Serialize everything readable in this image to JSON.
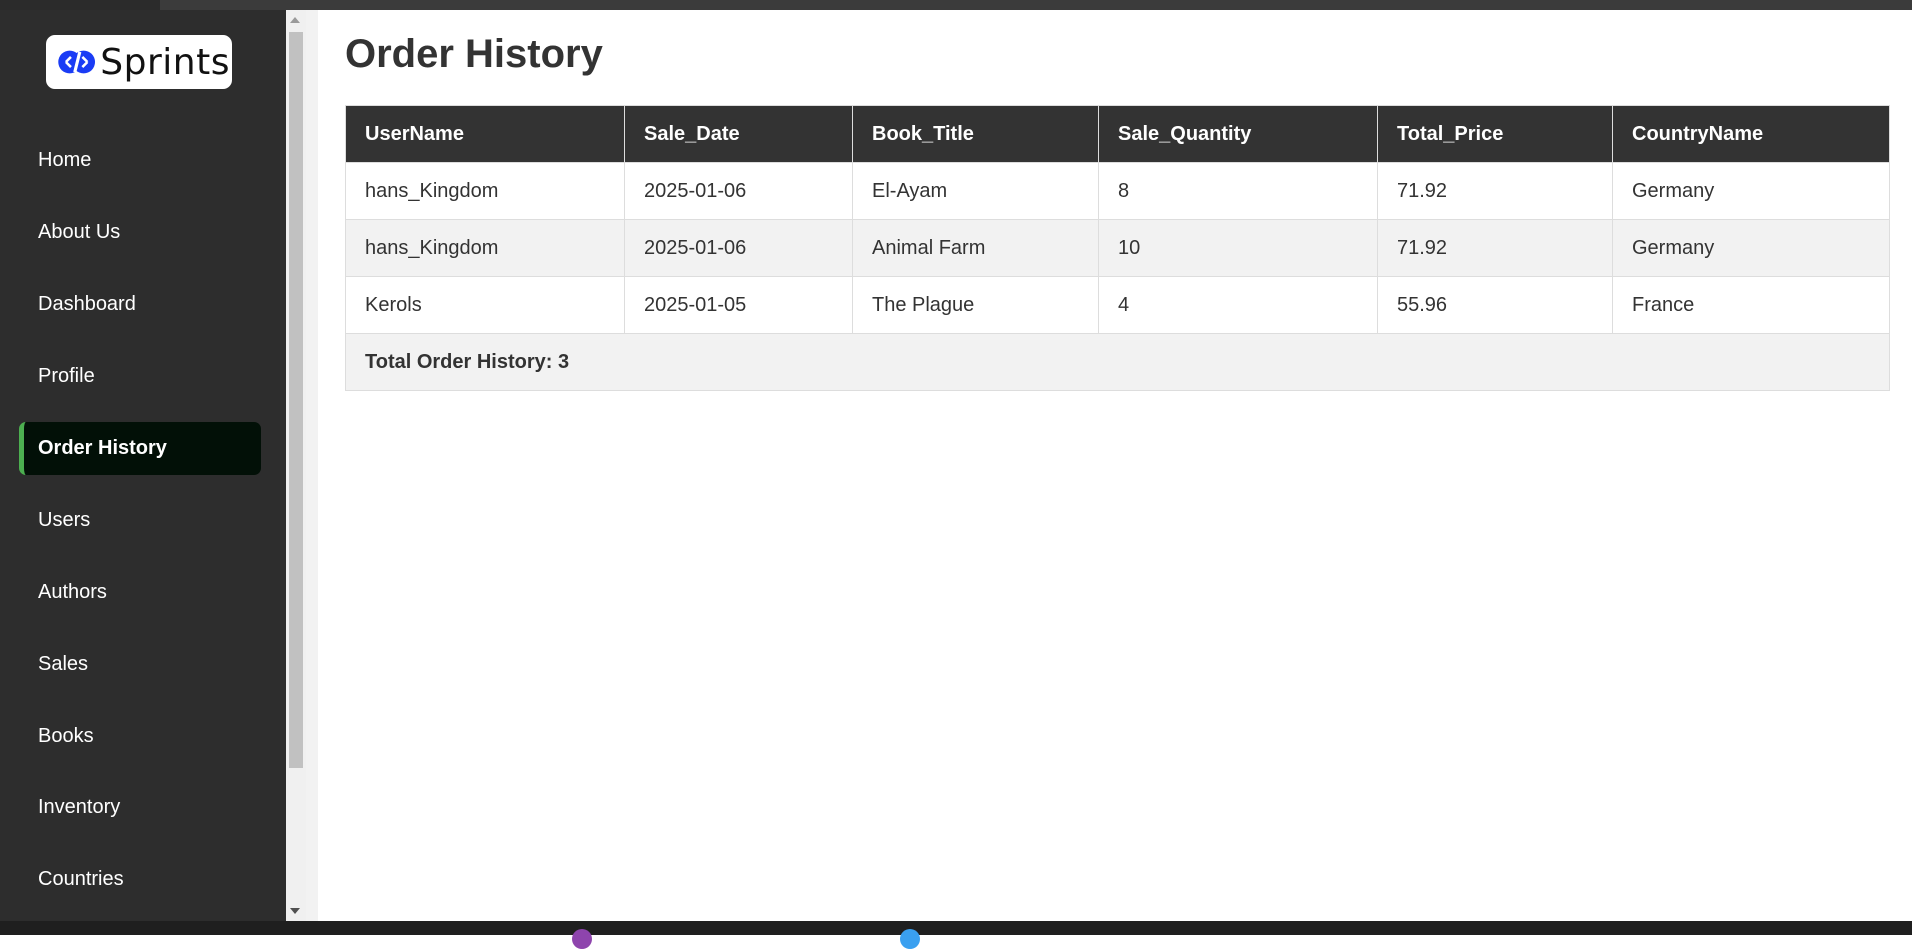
{
  "brand": {
    "logo_text": "Sprints",
    "logo_icon": "sprints-logo-icon",
    "logo_color": "#1a3cf5"
  },
  "sidebar": {
    "items": [
      {
        "label": "Home"
      },
      {
        "label": "About Us"
      },
      {
        "label": "Dashboard"
      },
      {
        "label": "Profile"
      },
      {
        "label": "Order History",
        "active": true
      },
      {
        "label": "Users"
      },
      {
        "label": "Authors"
      },
      {
        "label": "Sales"
      },
      {
        "label": "Books"
      },
      {
        "label": "Inventory"
      },
      {
        "label": "Countries"
      }
    ],
    "active_accent": "#4caf50"
  },
  "main": {
    "title": "Order History",
    "table": {
      "headers": [
        "UserName",
        "Sale_Date",
        "Book_Title",
        "Sale_Quantity",
        "Total_Price",
        "CountryName"
      ],
      "rows": [
        [
          "hans_Kingdom",
          "2025-01-06",
          "El-Ayam",
          "8",
          "71.92",
          "Germany"
        ],
        [
          "hans_Kingdom",
          "2025-01-06",
          "Animal Farm",
          "10",
          "71.92",
          "Germany"
        ],
        [
          "Kerols",
          "2025-01-05",
          "The Plague",
          "4",
          "55.96",
          "France"
        ]
      ],
      "total_label": "Total Order History: 3"
    }
  },
  "colors": {
    "sidebar_bg": "#2d2d2d",
    "header_bg": "#333333",
    "row_alt_bg": "#f2f2f2"
  }
}
